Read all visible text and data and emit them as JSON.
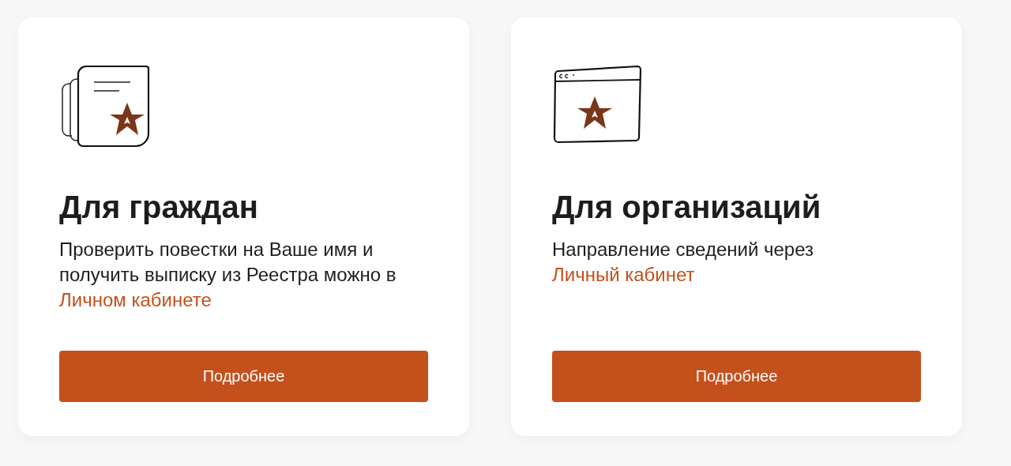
{
  "cards": [
    {
      "title": "Для граждан",
      "text": "Проверить повестки на Ваше имя и получить выписку из Реестра можно в ",
      "link": "Личном кабинете",
      "button": "Подробнее"
    },
    {
      "title": "Для организаций",
      "text": "Направление сведений через ",
      "link": "Личный кабинет",
      "button": "Подробнее"
    }
  ]
}
